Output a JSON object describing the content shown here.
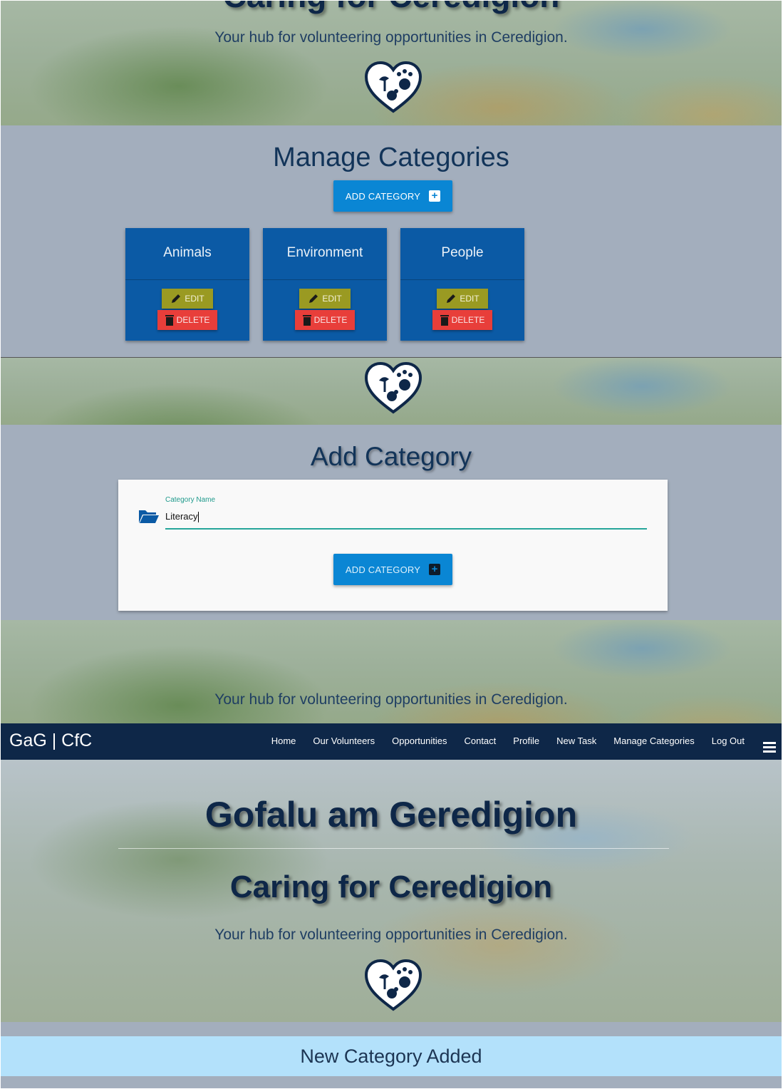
{
  "top_section": {
    "partial_title": "Caring for Ceredigion",
    "tagline": "Your hub for volunteering opportunities in Ceredigion."
  },
  "manage": {
    "title": "Manage Categories",
    "add_button": "ADD CATEGORY",
    "categories": [
      {
        "name": "Animals",
        "edit": "EDIT",
        "delete": "DELETE"
      },
      {
        "name": "Environment",
        "edit": "EDIT",
        "delete": "DELETE"
      },
      {
        "name": "People",
        "edit": "EDIT",
        "delete": "DELETE"
      }
    ]
  },
  "add_form": {
    "title": "Add Category",
    "field_label": "Category Name",
    "field_value": "Literacy",
    "submit": "ADD CATEGORY"
  },
  "hero_partial": {
    "tagline": "Your hub for volunteering opportunities in Ceredigion."
  },
  "navbar": {
    "brand": "GaG | CfC",
    "links": [
      "Home",
      "Our Volunteers",
      "Opportunities",
      "Contact",
      "Profile",
      "New Task",
      "Manage Categories",
      "Log Out"
    ]
  },
  "hero": {
    "welsh_title": "Gofalu am Geredigion",
    "english_title": "Caring for Ceredigion",
    "tagline": "Your hub for volunteering opportunities in Ceredigion."
  },
  "alert": {
    "message": "New Category Added"
  },
  "colors": {
    "navbar": "#0e2748",
    "card": "#0b5aa5",
    "accent_blue": "#0a86d4",
    "edit": "#9a9a22",
    "delete": "#e83e3a",
    "alert_bg": "#b3e1fb"
  }
}
